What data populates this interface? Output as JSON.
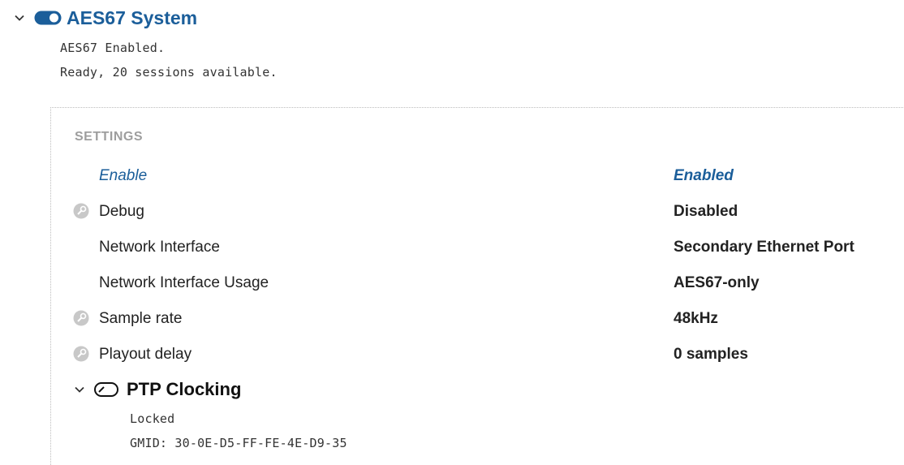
{
  "system": {
    "title": "AES67 System",
    "status_lines": [
      "AES67 Enabled.",
      "Ready, 20 sessions available."
    ]
  },
  "settings": {
    "section_label": "SETTINGS",
    "rows": [
      {
        "label": "Enable",
        "value": "Enabled"
      },
      {
        "label": "Debug",
        "value": "Disabled"
      },
      {
        "label": "Network Interface",
        "value": "Secondary Ethernet Port"
      },
      {
        "label": "Network Interface Usage",
        "value": "AES67-only"
      },
      {
        "label": "Sample rate",
        "value": "48kHz"
      },
      {
        "label": "Playout delay",
        "value": "0 samples"
      }
    ]
  },
  "ptp": {
    "title": "PTP Clocking",
    "status_lines": [
      "Locked",
      "GMID: 30-0E-D5-FF-FE-4E-D9-35"
    ]
  },
  "icons": {
    "expand": "chevron-down-icon",
    "system_state": "toggle-on-icon",
    "ptp_state": "toggle-off-icon",
    "locked_setting": "lock-icon"
  },
  "colors": {
    "accent": "#1b5e9a",
    "muted": "#9e9e9e",
    "lock_icon": "#c8c8c8"
  }
}
